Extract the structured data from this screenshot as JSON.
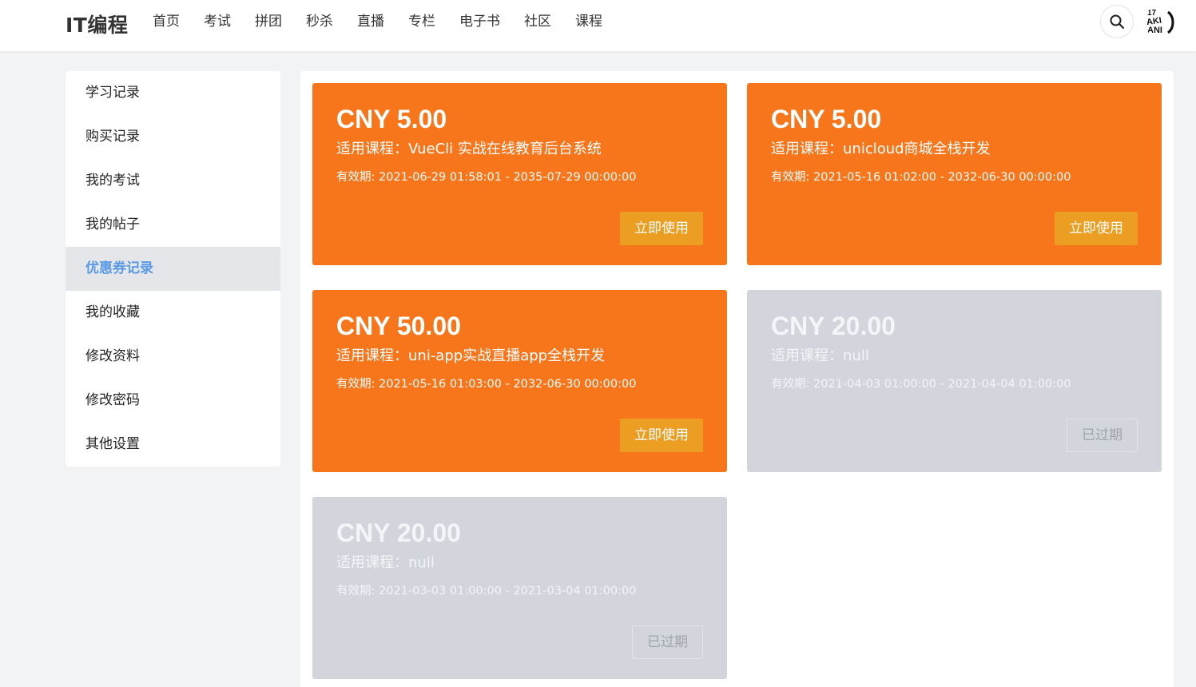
{
  "header": {
    "brand": "IT编程",
    "nav": [
      "首页",
      "考试",
      "拼团",
      "秒杀",
      "直播",
      "专栏",
      "电子书",
      "社区",
      "课程"
    ],
    "search_icon": "search-icon",
    "avatar_text": "AKI"
  },
  "sidebar": {
    "items": [
      {
        "label": "学习记录",
        "active": false
      },
      {
        "label": "购买记录",
        "active": false
      },
      {
        "label": "我的考试",
        "active": false
      },
      {
        "label": "我的帖子",
        "active": false
      },
      {
        "label": "优惠券记录",
        "active": true
      },
      {
        "label": "我的收藏",
        "active": false
      },
      {
        "label": "修改资料",
        "active": false
      },
      {
        "label": "修改密码",
        "active": false
      },
      {
        "label": "其他设置",
        "active": false
      }
    ],
    "active_color": "#5b9be6"
  },
  "coupons": [
    {
      "amount": "CNY 5.00",
      "course": "适用课程：VueCli 实战在线教育后台系统",
      "validity": "有效期: 2021-06-29 01:58:01 - 2035-07-29 00:00:00",
      "button": "立即使用",
      "status": "active"
    },
    {
      "amount": "CNY 5.00",
      "course": "适用课程：unicloud商城全栈开发",
      "validity": "有效期: 2021-05-16 01:02:00 - 2032-06-30 00:00:00",
      "button": "立即使用",
      "status": "active"
    },
    {
      "amount": "CNY 50.00",
      "course": "适用课程：uni-app实战直播app全栈开发",
      "validity": "有效期: 2021-05-16 01:03:00 - 2032-06-30 00:00:00",
      "button": "立即使用",
      "status": "active"
    },
    {
      "amount": "CNY 20.00",
      "course": "适用课程：null",
      "validity": "有效期: 2021-04-03 01:00:00 - 2021-04-04 01:00:00",
      "button": "已过期",
      "status": "expired"
    },
    {
      "amount": "CNY 20.00",
      "course": "适用课程：null",
      "validity": "有效期: 2021-03-03 01:00:00 - 2021-03-04 01:00:00",
      "button": "已过期",
      "status": "expired"
    }
  ],
  "colors": {
    "active_card": "#f8761b",
    "active_button": "#eb9e22",
    "expired_card": "#d2d5dc"
  }
}
